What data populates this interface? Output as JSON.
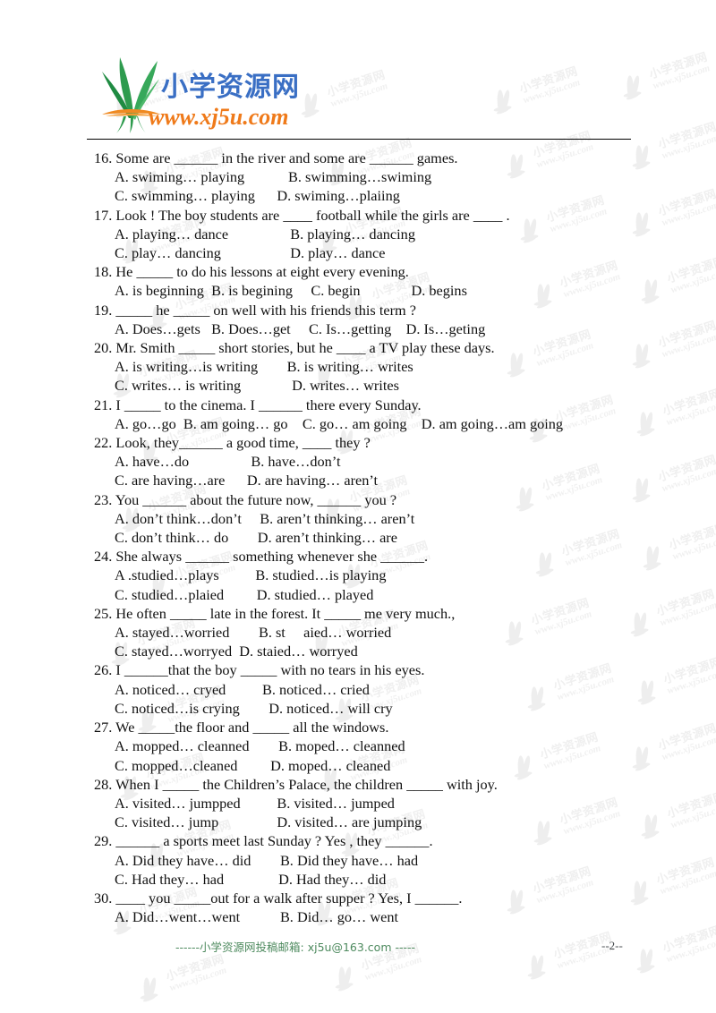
{
  "header": {
    "logo_cn": "小学资源网",
    "logo_url": "www.xj5u.com",
    "logo_cn_color": "#3a6fc4",
    "logo_url_color": "#ef7a1a",
    "logo_leaf_color": "#2e9b4e",
    "logo_root_color": "#ef8a22"
  },
  "watermark": {
    "cn": "小学资源网",
    "url": "www.xj5u.com",
    "color": "#cccccc"
  },
  "questions": [
    {
      "number": "16.",
      "stem": "16. Some are ______ in the river and some are ______ games.",
      "options": [
        "A. swiming… playing            B. swimming…swiming",
        "C. swimming… playing      D. swiming…plaiing"
      ]
    },
    {
      "number": "17.",
      "stem": "17. Look ! The boy students are ____ football while the girls are ____ .",
      "options": [
        "A. playing… dance                 B. playing… dancing",
        "C. play… dancing                   D. play… dance"
      ]
    },
    {
      "number": "18.",
      "stem": "18. He _____ to do his lessons at eight every evening.",
      "options": [
        "A. is beginning  B. is begining     C. begin              D. begins"
      ]
    },
    {
      "number": "19.",
      "stem": "19. _____ he _____ on well with his friends this term ?",
      "options": [
        "A. Does…gets   B. Does…get     C. Is…getting    D. Is…geting"
      ]
    },
    {
      "number": "20.",
      "stem": "20. Mr. Smith _____ short stories, but he ____ a TV play these days.",
      "options": [
        "A. is writing…is writing        B. is writing… writes",
        "C. writes… is writing              D. writes… writes"
      ]
    },
    {
      "number": "21.",
      "stem": "21. I _____ to the cinema. I ______ there every Sunday.",
      "options": [
        "A. go…go  B. am going… go    C. go… am going    D. am going…am going"
      ]
    },
    {
      "number": "22.",
      "stem": "22. Look, they______ a good time, ____ they ?",
      "options": [
        "A. have…do                 B. have…don’t",
        "C. are having…are      D. are having… aren’t"
      ]
    },
    {
      "number": "23.",
      "stem": "23. You ______ about the future now, ______ you ?",
      "options": [
        "A. don’t think…don’t     B. aren’t thinking… aren’t",
        "C. don’t think… do        D. aren’t thinking… are"
      ]
    },
    {
      "number": "24.",
      "stem": "24. She always ______ something whenever she ______.",
      "options": [
        "A .studied…plays          B. studied…is playing",
        "C. studied…plaied         D. studied… played"
      ]
    },
    {
      "number": "25.",
      "stem": "25. He often _____ late in the forest. It _____ me very much.,",
      "options": [
        "A. stayed…worried        B. st     aied… worried",
        "C. stayed…worryed  D. staied… worryed"
      ]
    },
    {
      "number": "26.",
      "stem": "26. I ______that the boy _____ with no tears in his eyes.",
      "options": [
        "A. noticed… cryed          B. noticed… cried",
        "C. noticed…is crying        D. noticed… will cry"
      ]
    },
    {
      "number": "27.",
      "stem": "27. We _____the floor and _____ all the windows.",
      "options": [
        "A. mopped… cleanned        B. moped… cleanned",
        "C. mopped…cleaned         D. moped… cleaned"
      ]
    },
    {
      "number": "28.",
      "stem": "28. When I _____ the Children’s Palace, the children _____ with joy.",
      "options": [
        "A. visited… jumpped          B. visited… jumped",
        "C. visited… jump                D. visited… are jumping"
      ]
    },
    {
      "number": "29.",
      "stem": "29. ______ a sports meet last Sunday ? Yes , they ______.",
      "options": [
        "A. Did they have… did        B. Did they have… had",
        "C. Had they… had               D. Had they… did"
      ]
    },
    {
      "number": "30.",
      "stem": "30. ____ you _____out for a walk after supper ? Yes, I ______.",
      "options": [
        "A. Did…went…went           B. Did… go… went"
      ]
    }
  ],
  "footer": {
    "note": "------小学资源网投稿邮箱: xj5u@163.com -----",
    "note_color": "#4d8a5e",
    "page_number": "--2--"
  }
}
